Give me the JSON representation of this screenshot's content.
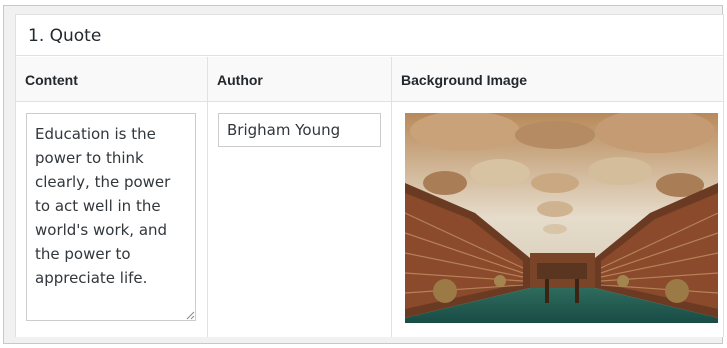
{
  "panel": {
    "title": "1. Quote"
  },
  "columns": {
    "content": "Content",
    "author": "Author",
    "background": "Background Image"
  },
  "row": {
    "content_value": "Education is the\npower to think\nclearly, the power\nto act well in the\nworld's work, and\nthe power to\nappreciate life.",
    "author_value": "Brigham Young",
    "background_image": "library-hall-image"
  },
  "colors": {
    "header_bg": "#f9f9f9",
    "border": "#e1e1e1",
    "text": "#23282d"
  }
}
